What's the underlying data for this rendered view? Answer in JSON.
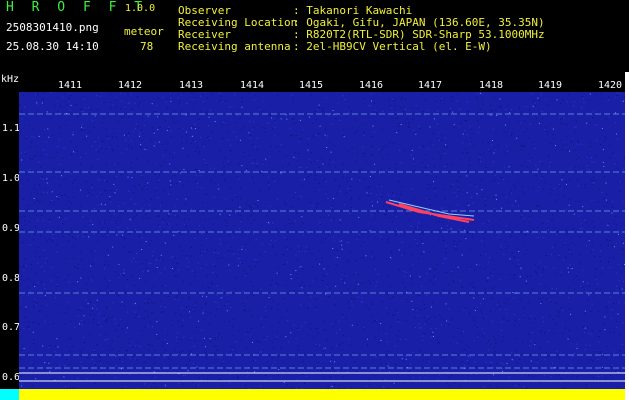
{
  "header": {
    "app_title": "H R O F F T",
    "version": "1.0.0",
    "filename": "2508301410.png",
    "detection_label": "meteor",
    "timestamp": "25.08.30 14:10",
    "detection_count": "78",
    "meta": [
      {
        "key": "Observer",
        "value": ": Takanori Kawachi"
      },
      {
        "key": "Receiving Location",
        "value": ": Ogaki, Gifu, JAPAN (136.60E, 35.35N)"
      },
      {
        "key": "Receiver",
        "value": ": R820T2(RTL-SDR) SDR-Sharp 53.1000MHz"
      },
      {
        "key": "Receiving antenna",
        "value": ": 2el-HB9CV Vertical (el. E-W)"
      }
    ]
  },
  "axes": {
    "unit": "kHz",
    "x_ticks": [
      "1411",
      "1412",
      "1413",
      "1414",
      "1415",
      "1416",
      "1417",
      "1418",
      "1419",
      "1420"
    ],
    "y_ticks": [
      "1.1",
      "1.0",
      "0.9",
      "0.8",
      "0.7",
      "0.6"
    ]
  },
  "colors": {
    "background": "#1a1fa8",
    "trace": "#8fd0ff",
    "meteor": "#ff4060",
    "bottom_bar": "#ffff00",
    "header_green": "#3cf03c",
    "header_yellow": "#f0f03c"
  }
}
